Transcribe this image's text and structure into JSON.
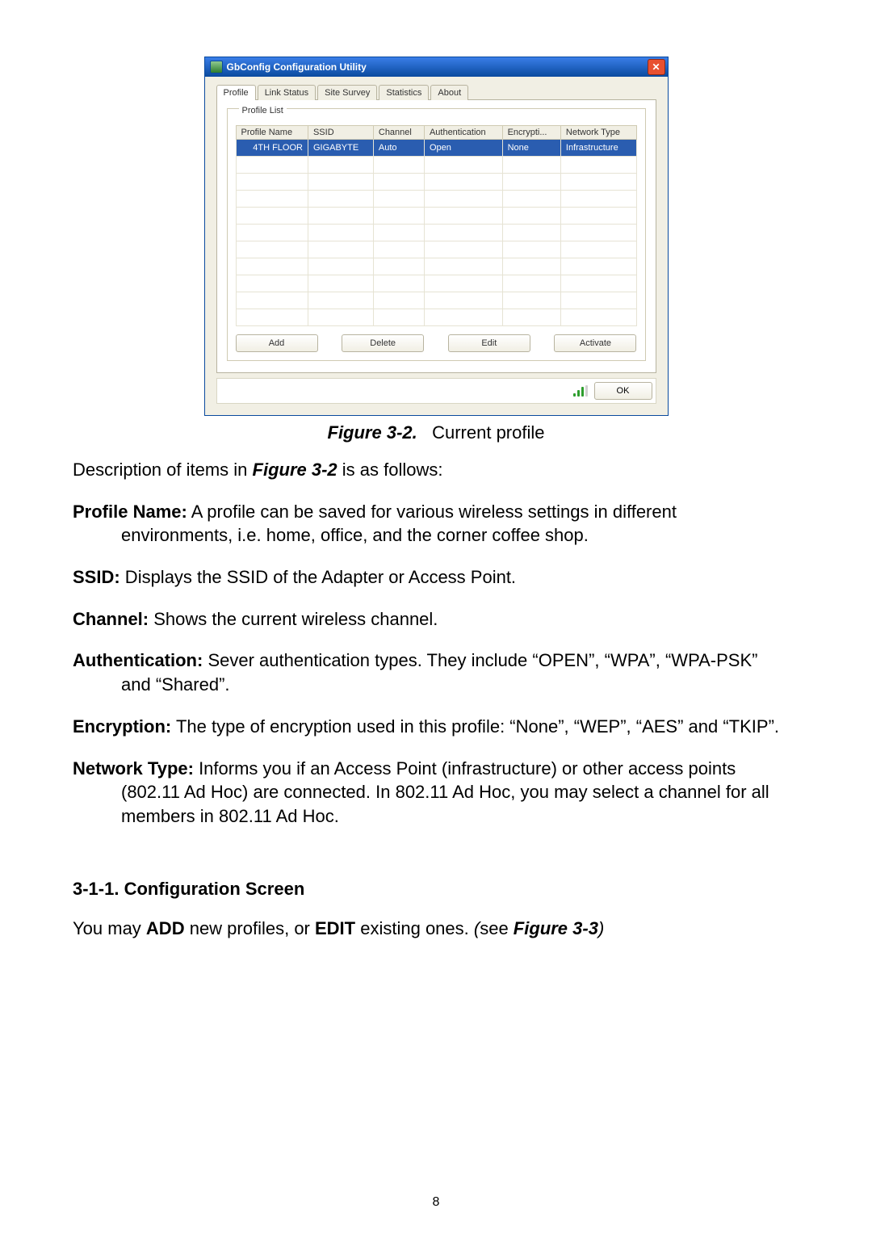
{
  "window": {
    "title": "GbConfig Configuration Utility",
    "tabs": [
      "Profile",
      "Link Status",
      "Site Survey",
      "Statistics",
      "About"
    ],
    "active_tab_index": 0,
    "groupbox_label": "Profile List",
    "columns": [
      "Profile Name",
      "SSID",
      "Channel",
      "Authentication",
      "Encrypti...",
      "Network Type"
    ],
    "row": {
      "profile_name": "4TH FLOOR",
      "ssid": "GIGABYTE",
      "channel": "Auto",
      "auth": "Open",
      "enc": "None",
      "net": "Infrastructure"
    },
    "buttons": {
      "add": "Add",
      "delete": "Delete",
      "edit": "Edit",
      "activate": "Activate",
      "ok": "OK"
    }
  },
  "caption": {
    "fig": "Figure 3-2.",
    "label": "Current profile"
  },
  "intro": {
    "pre": "Description of items in ",
    "figref": "Figure 3-2",
    "post": " is as follows:"
  },
  "items": {
    "profile_name": {
      "t": "Profile Name:",
      "line1": " A profile can be saved for various wireless settings in different",
      "line2": "environments, i.e. home, office, and the corner coffee shop."
    },
    "ssid": {
      "t": "SSID:",
      "b": " Displays the SSID of the Adapter or Access Point."
    },
    "channel": {
      "t": "Channel:",
      "b": " Shows the current wireless channel."
    },
    "auth": {
      "t": "Authentication:",
      "line1": " Sever authentication types. They include “OPEN”, “WPA”, “WPA-PSK”",
      "line2": "and “Shared”."
    },
    "enc": {
      "t": "Encryption:",
      "b": " The type of encryption used in this profile: “None”, “WEP”, “AES” and “TKIP”."
    },
    "net": {
      "t": "Network Type:",
      "line1": " Informs you if an Access Point (infrastructure) or other access points",
      "line2": "(802.11 Ad Hoc) are connected. In 802.11 Ad Hoc, you may select a channel for all",
      "line3": "members in 802.11 Ad Hoc."
    }
  },
  "section": {
    "num": "3-1-1. Configuration Screen"
  },
  "config_line": {
    "a": "You may ",
    "add": "ADD",
    "b": " new profiles, or ",
    "edit": "EDIT",
    "c": " existing ones. ",
    "see_open": "(",
    "see": "see ",
    "figref": "Figure 3-3",
    "see_close": ")"
  },
  "page_number": "8"
}
